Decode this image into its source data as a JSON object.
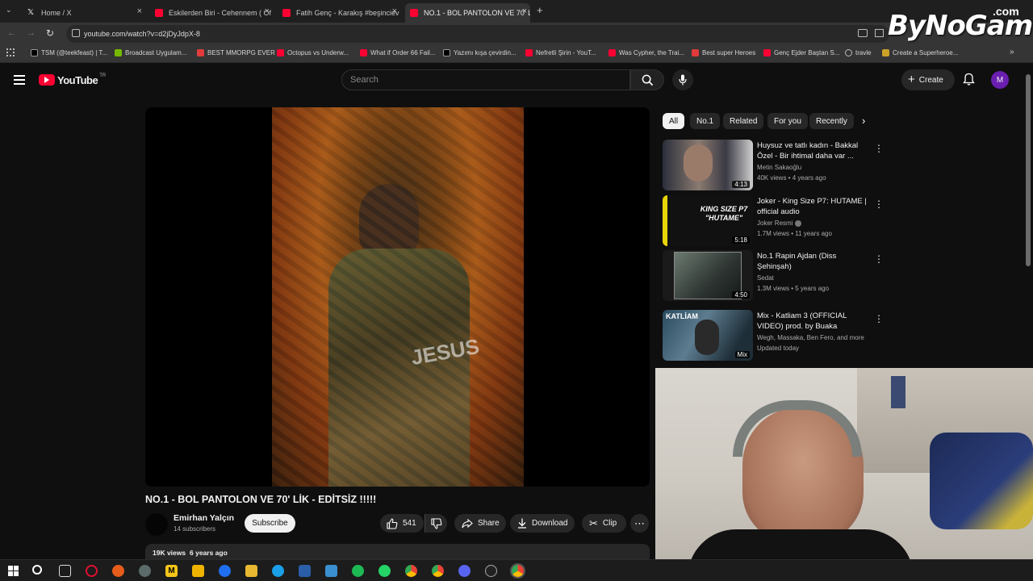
{
  "browser": {
    "tabs": [
      {
        "label": "Home / X",
        "active": false
      },
      {
        "label": "Eskilerden Biri - Cehennem ( Of",
        "active": false
      },
      {
        "label": "Fatih Genç - Karakış #beşinciev",
        "active": false
      },
      {
        "label": "NO.1 - BOL PANTOLON VE 70' L",
        "active": true
      }
    ],
    "url": "youtube.com/watch?v=d2jDyJdpX-8",
    "bookmarks": [
      "TSM (@teekfeast) | T...",
      "Broadcast Uygulam...",
      "BEST MMORPG EVER",
      "Octopus vs Underw...",
      "What if Order 66 Fail...",
      "Yazımı kışa çevirdin...",
      "Nefretli Şirin - YouT...",
      "Was Cypher, the Trai...",
      "Best super Heroes",
      "Genç Ejder Baştan S...",
      "travle",
      "Create a Superheroe..."
    ]
  },
  "watermark": {
    "brand": "ByNoGame",
    "suffix": ".com"
  },
  "youtube": {
    "logo_text": "YouTube",
    "region": "TR",
    "search_placeholder": "Search",
    "create_label": "Create",
    "avatar_letter": "M",
    "video_overlay_text": "JESUS",
    "video_title": "NO.1 - BOL PANTOLON VE 70' LİK - EDİTSİZ !!!!!",
    "channel_name": "Emirhan Yalçın",
    "subscribers": "14 subscribers",
    "subscribe_label": "Subscribe",
    "like_count": "541",
    "share_label": "Share",
    "download_label": "Download",
    "clip_label": "Clip",
    "views": "19K views",
    "uploaded": "6 years ago",
    "chips": [
      "All",
      "No.1",
      "Related",
      "For you",
      "Recently"
    ],
    "recommendations": [
      {
        "title": "Huysuz ve tatlı kadın - Bakkal Özel - Bir ihtimal daha var ...",
        "channel": "Metin Sakaoğlu",
        "meta": "40K views • 4 years ago",
        "duration": "4:13"
      },
      {
        "title": "Joker - King Size P7: HUTAME | official audio",
        "channel": "Joker Resmi",
        "meta": "1.7M views • 11 years ago",
        "duration": "5:18",
        "thumb_text": "KING SIZE P7 \"HUTAME\""
      },
      {
        "title": "No.1 Rapin Ajdan (Diss Şehinşah)",
        "channel": "Sedat",
        "meta": "1.3M views • 5 years ago",
        "duration": "4:50"
      },
      {
        "title": "Mix - Katliam 3 (OFFICIAL VIDEO) prod. by Buaka",
        "channel": "Wegh, Massaka, Ben Fero, and more",
        "meta": "Updated today",
        "duration": "Mix",
        "thumb_text": "KATLİAM"
      }
    ]
  }
}
